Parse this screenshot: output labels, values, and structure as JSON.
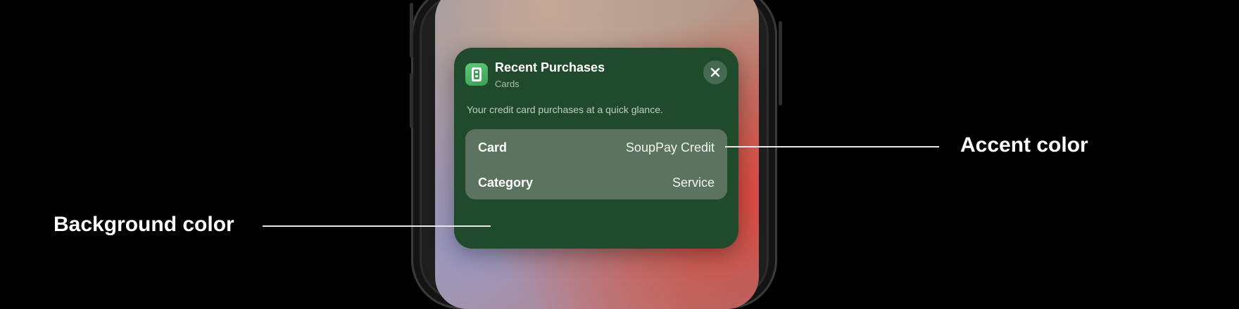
{
  "widget": {
    "app_name": "Recent Purchases",
    "app_subtitle": "Cards",
    "description": "Your credit card purchases at a quick glance.",
    "rows": [
      {
        "label": "Card",
        "value": "SoupPay Credit"
      },
      {
        "label": "Category",
        "value": "Service"
      }
    ],
    "background_color": "#1f4a2c",
    "accent_color": "#5c735f",
    "icon": "card-app-icon",
    "close_icon": "close-icon"
  },
  "callouts": {
    "accent": "Accent color",
    "background": "Background color"
  }
}
